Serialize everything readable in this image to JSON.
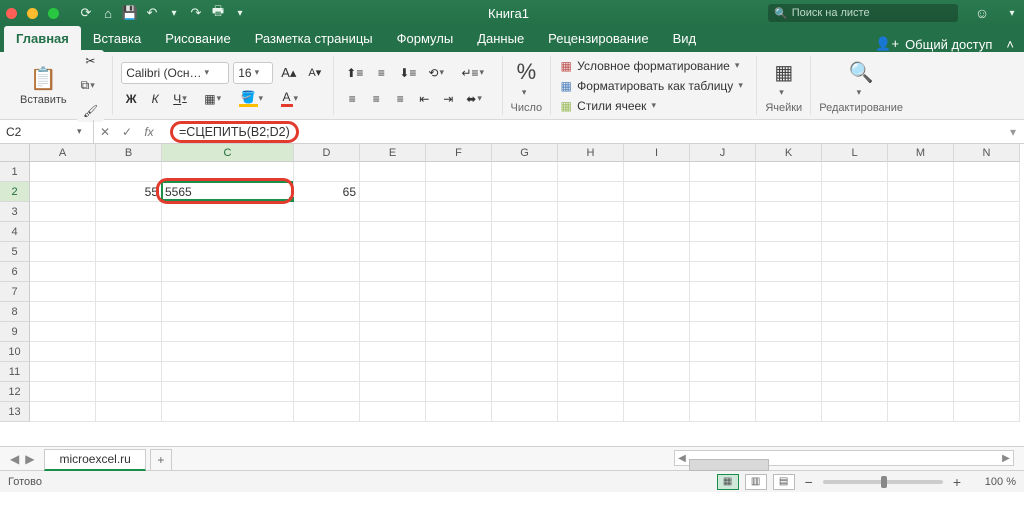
{
  "window": {
    "title": "Книга1"
  },
  "search": {
    "placeholder": "Поиск на листе"
  },
  "qat": {
    "autosave_icon": "autosave-icon",
    "home_icon": "home-icon",
    "save_icon": "save-icon",
    "undo_icon": "undo-icon",
    "redo_icon": "redo-icon",
    "print_icon": "print-icon"
  },
  "tabs": {
    "items": [
      {
        "label": "Главная",
        "active": true
      },
      {
        "label": "Вставка"
      },
      {
        "label": "Рисование"
      },
      {
        "label": "Разметка страницы"
      },
      {
        "label": "Формулы"
      },
      {
        "label": "Данные"
      },
      {
        "label": "Рецензирование"
      },
      {
        "label": "Вид"
      }
    ],
    "share": "Общий доступ"
  },
  "ribbon": {
    "paste": "Вставить",
    "font_name": "Calibri (Осн…",
    "font_size": "16",
    "bold": "Ж",
    "italic": "К",
    "underline": "Ч",
    "number_label": "Число",
    "cond_fmt": "Условное форматирование",
    "as_table": "Форматировать как таблицу",
    "cell_styles": "Стили ячеек",
    "cells": "Ячейки",
    "editing": "Редактирование"
  },
  "formula_bar": {
    "cell_ref": "C2",
    "formula": "=СЦЕПИТЬ(B2;D2)"
  },
  "columns": [
    "A",
    "B",
    "C",
    "D",
    "E",
    "F",
    "G",
    "H",
    "I",
    "J",
    "K",
    "L",
    "M",
    "N"
  ],
  "rows": [
    1,
    2,
    3,
    4,
    5,
    6,
    7,
    8,
    9,
    10,
    11,
    12,
    13
  ],
  "data": {
    "B2": "55",
    "C2": "5565",
    "D2": "65"
  },
  "active_col": "C",
  "active_row": 2,
  "sheet": {
    "name": "microexcel.ru"
  },
  "status": {
    "ready": "Готово",
    "zoom": "100 %"
  }
}
